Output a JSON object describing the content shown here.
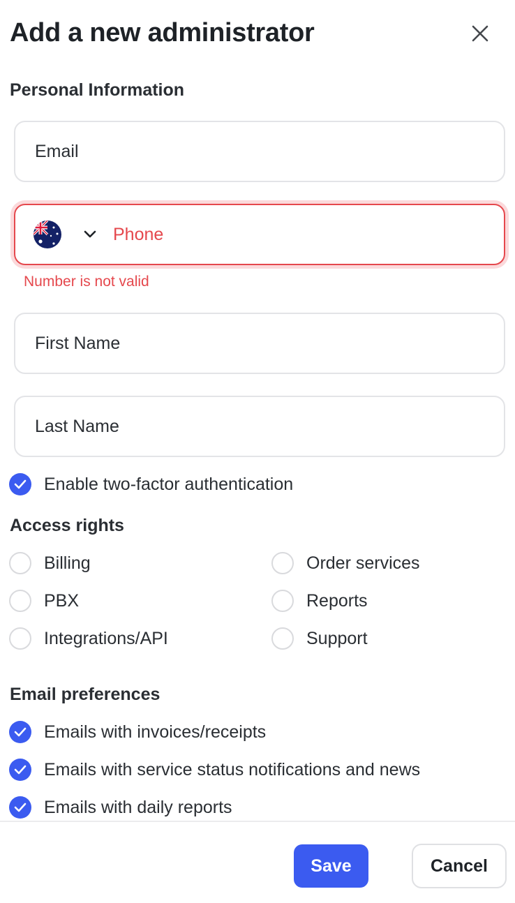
{
  "dialog": {
    "title": "Add a new administrator",
    "close_icon": "close-icon"
  },
  "personal": {
    "heading": "Personal Information",
    "email_placeholder": "Email",
    "phone": {
      "country_flag": "australia-flag-icon",
      "placeholder": "Phone",
      "error": "Number is not valid"
    },
    "first_name_placeholder": "First Name",
    "last_name_placeholder": "Last Name",
    "two_factor": {
      "label": "Enable two-factor authentication",
      "checked": true
    }
  },
  "access": {
    "heading": "Access rights",
    "items": [
      {
        "label": "Billing",
        "checked": false
      },
      {
        "label": "Order services",
        "checked": false
      },
      {
        "label": "PBX",
        "checked": false
      },
      {
        "label": "Reports",
        "checked": false
      },
      {
        "label": "Integrations/API",
        "checked": false
      },
      {
        "label": "Support",
        "checked": false
      }
    ]
  },
  "email_prefs": {
    "heading": "Email preferences",
    "items": [
      {
        "label": "Emails with invoices/receipts",
        "checked": true
      },
      {
        "label": "Emails with service status notifications and news",
        "checked": true
      },
      {
        "label": "Emails with daily reports",
        "checked": true
      }
    ]
  },
  "footer": {
    "save_label": "Save",
    "cancel_label": "Cancel"
  },
  "colors": {
    "accent": "#3b5bf0",
    "error": "#e5484d",
    "error_ring": "#fbd9db",
    "border": "#e3e4e7"
  }
}
